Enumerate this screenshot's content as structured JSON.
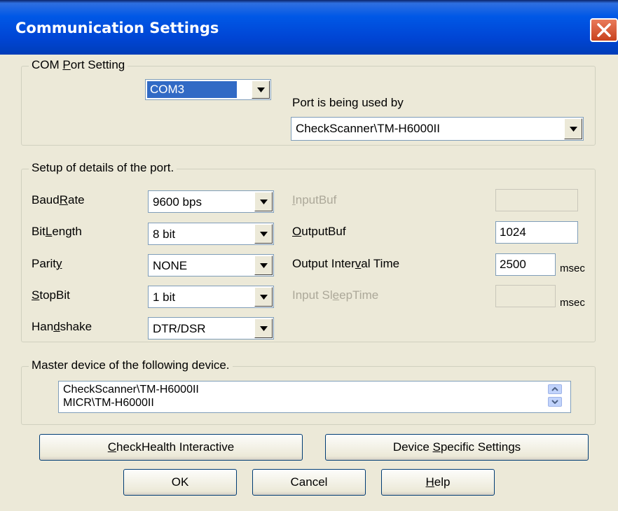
{
  "window": {
    "title": "Communication Settings"
  },
  "com_port": {
    "group_label_pre": "COM ",
    "group_label_u": "P",
    "group_label_post": "ort Setting",
    "port_value": "COM3",
    "used_by_label": "Port is being used by",
    "used_by_value": "CheckScanner\\TM-H6000II"
  },
  "details": {
    "group_label": "Setup of details of the port.",
    "baudrate_label_pre": "Baud",
    "baudrate_label_u": "R",
    "baudrate_label_post": "ate",
    "baudrate_value": "9600 bps",
    "bitlength_label_pre": "Bit",
    "bitlength_label_u": "L",
    "bitlength_label_post": "ength",
    "bitlength_value": "8 bit",
    "parity_label_pre": "Parit",
    "parity_label_u": "y",
    "parity_value": "NONE",
    "stopbit_label_pre": "",
    "stopbit_label_u": "S",
    "stopbit_label_post": "topBit",
    "stopbit_value": "1 bit",
    "handshake_label_pre": "Han",
    "handshake_label_u": "d",
    "handshake_label_post": "shake",
    "handshake_value": "DTR/DSR",
    "inputbuf_label_pre": "",
    "inputbuf_label_u": "I",
    "inputbuf_label_post": "nputBuf",
    "inputbuf_value": "",
    "outputbuf_label_pre": "",
    "outputbuf_label_u": "O",
    "outputbuf_label_post": "utputBuf",
    "outputbuf_value": "1024",
    "output_interval_label_pre": "Output Inter",
    "output_interval_label_u": "v",
    "output_interval_label_post": "al Time",
    "output_interval_value": "2500",
    "output_interval_unit": "msec",
    "input_sleep_label_pre": "Input Sl",
    "input_sleep_label_u": "e",
    "input_sleep_label_post": "epTime",
    "input_sleep_value": "",
    "input_sleep_unit": "msec"
  },
  "master": {
    "group_label": "Master device of the following device.",
    "items": [
      "CheckScanner\\TM-H6000II",
      "MICR\\TM-H6000II"
    ]
  },
  "buttons": {
    "checkhealth_u": "C",
    "checkhealth_post": "heckHealth Interactive",
    "device_specific_pre": "Device ",
    "device_specific_u": "S",
    "device_specific_post": "pecific Settings",
    "ok": "OK",
    "cancel": "Cancel",
    "help_u": "H",
    "help_post": "elp"
  },
  "colors": {
    "titlebar": "#0058e6",
    "dialog_bg": "#ece9d8",
    "selection": "#316ac5",
    "close_button": "#d5502c"
  },
  "icons": [
    "close-icon",
    "dropdown-arrow-icon",
    "scroll-up-icon",
    "scroll-down-icon"
  ]
}
